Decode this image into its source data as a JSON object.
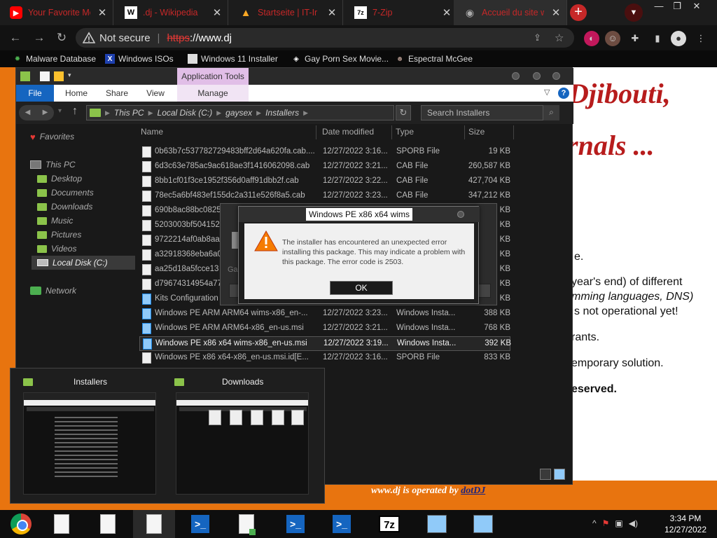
{
  "chrome": {
    "tabs": [
      {
        "title": "Your Favorite Mo",
        "icon": "youtube-icon",
        "fav_text": "▶",
        "fav_bg": "#ff0000"
      },
      {
        "title": ".dj - Wikipedia",
        "icon": "wikipedia-icon",
        "fav_text": "W",
        "fav_bg": "#ffffff"
      },
      {
        "title": "Startseite | IT-Ir",
        "icon": "warning-icon",
        "fav_text": "!",
        "fav_bg": "#f9a825"
      },
      {
        "title": "7-Zip",
        "icon": "7zip-icon",
        "fav_text": "7z",
        "fav_bg": "#ffffff"
      },
      {
        "title": "Accueil du site w",
        "icon": "globe-icon",
        "fav_text": "◉",
        "fav_bg": "#555555"
      }
    ],
    "new_tab": "+",
    "address": {
      "security": "Not secure",
      "scheme": "https",
      "rest": "://www.dj"
    },
    "bookmarks": [
      "Malware Database",
      "Windows ISOs",
      "Windows 11 Installer",
      "Gay Porn Sex Movie...",
      "Espectral McGee"
    ]
  },
  "webpage": {
    "heading1": "Djibouti,",
    "heading2": "rnals ...",
    "lines": [
      "e.",
      "year's end) of different",
      "mming languages, DNS)",
      "s not operational yet!",
      "rants.",
      "emporary solution.",
      "eserved."
    ],
    "footer_text": "www.dj is operated by",
    "footer_link": "dotDJ"
  },
  "explorer": {
    "app_tools": "Application Tools",
    "ribbon_tabs": [
      "File",
      "Home",
      "Share",
      "View",
      "Manage"
    ],
    "breadcrumb": [
      "This PC",
      "Local Disk (C:)",
      "gaysex",
      "Installers"
    ],
    "search_placeholder": "Search Installers",
    "nav": {
      "favorites": "Favorites",
      "this_pc": "This PC",
      "folders": [
        "Desktop",
        "Documents",
        "Downloads",
        "Music",
        "Pictures",
        "Videos"
      ],
      "local_disk": "Local Disk (C:)",
      "network": "Network"
    },
    "columns": [
      "Name",
      "Date modified",
      "Type",
      "Size"
    ],
    "files": [
      {
        "name": "0b63b7c537782729483bff2d64a620fa.cab....",
        "date": "12/27/2022 3:16...",
        "type": "SPORB File",
        "size": "19 KB",
        "kind": "doc"
      },
      {
        "name": "6d3c63e785ac9ac618ae3f1416062098.cab",
        "date": "12/27/2022 3:21...",
        "type": "CAB File",
        "size": "260,587 KB",
        "kind": "doc"
      },
      {
        "name": "8bb1cf01f3ce1952f356d0aff91dbb2f.cab",
        "date": "12/27/2022 3:22...",
        "type": "CAB File",
        "size": "427,704 KB",
        "kind": "doc"
      },
      {
        "name": "78ec5a6bf483ef155dc2a311e526f8a5.cab",
        "date": "12/27/2022 3:23...",
        "type": "CAB File",
        "size": "347,212 KB",
        "kind": "doc"
      },
      {
        "name": "690b8ac88bc0825",
        "date": "",
        "type": "",
        "size": "KB",
        "kind": "doc"
      },
      {
        "name": "5203003bf504152",
        "date": "",
        "type": "",
        "size": "KB",
        "kind": "doc"
      },
      {
        "name": "9722214af0ab8aa",
        "date": "",
        "type": "",
        "size": "KB",
        "kind": "doc"
      },
      {
        "name": "a32918368eba6a0",
        "date": "",
        "type": "",
        "size": "KB",
        "kind": "doc"
      },
      {
        "name": "aa25d18a5fcce13",
        "date": "",
        "type": "",
        "size": "KB",
        "kind": "doc"
      },
      {
        "name": "d79674314954a77",
        "date": "",
        "type": "",
        "size": "KB",
        "kind": "doc"
      },
      {
        "name": "Kits Configuration",
        "date": "",
        "type": "",
        "size": "KB",
        "kind": "msi"
      },
      {
        "name": "Windows PE ARM ARM64 wims-x86_en-...",
        "date": "12/27/2022 3:23...",
        "type": "Windows Insta...",
        "size": "388 KB",
        "kind": "msi"
      },
      {
        "name": "Windows PE ARM ARM64-x86_en-us.msi",
        "date": "12/27/2022 3:21...",
        "type": "Windows Insta...",
        "size": "768 KB",
        "kind": "msi"
      },
      {
        "name": "Windows PE x86 x64 wims-x86_en-us.msi",
        "date": "12/27/2022 3:19...",
        "type": "Windows Insta...",
        "size": "392 KB",
        "kind": "msi",
        "selected": true
      },
      {
        "name": "Windows PE x86 x64-x86_en-us.msi.id[E...",
        "date": "12/27/2022 3:16...",
        "type": "SPORB File",
        "size": "833 KB",
        "kind": "doc"
      }
    ]
  },
  "bg_dialog": {
    "label": "Ga"
  },
  "error_dialog": {
    "title": "Windows PE x86 x64 wims",
    "message": "The installer has encountered an unexpected error installing this package. This may indicate a problem with this package. The error code is 2503.",
    "ok": "OK"
  },
  "thumbnails": [
    {
      "title": "Installers"
    },
    {
      "title": "Downloads"
    }
  ],
  "taskbar": {
    "time": "3:34 PM",
    "date": "12/27/2022",
    "sevenzip": "7z",
    "ps": ">_"
  }
}
